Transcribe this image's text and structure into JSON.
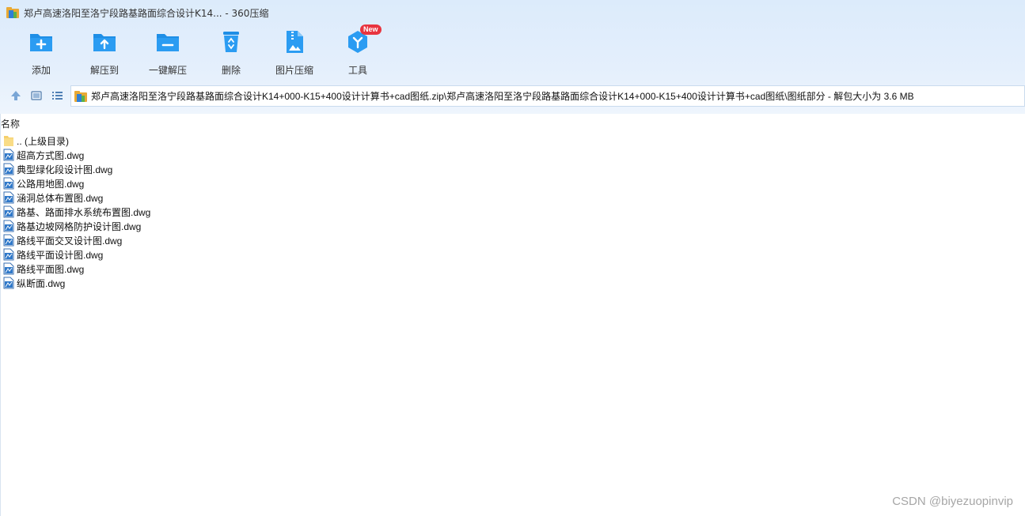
{
  "window": {
    "title": "郑卢高速洛阳至洛宁段路基路面综合设计K14... - 360压缩"
  },
  "toolbar": {
    "items": [
      {
        "label": "添加",
        "icon": "add-folder-icon"
      },
      {
        "label": "解压到",
        "icon": "extract-to-icon"
      },
      {
        "label": "一键解压",
        "icon": "one-click-extract-icon"
      },
      {
        "label": "删除",
        "icon": "recycle-bin-icon"
      },
      {
        "label": "图片压缩",
        "icon": "image-compress-icon"
      },
      {
        "label": "工具",
        "icon": "tools-icon",
        "badge": "New"
      }
    ]
  },
  "navigation": {
    "path": "郑卢高速洛阳至洛宁段路基路面综合设计K14+000-K15+400设计计算书+cad图纸.zip\\郑卢高速洛阳至洛宁段路基路面综合设计K14+000-K15+400设计计算书+cad图纸\\图纸部分 - 解包大小为 3.6 MB"
  },
  "list": {
    "column_name": "名称",
    "parent_dir": ".. (上级目录)",
    "files": [
      "超高方式图.dwg",
      "典型绿化段设计图.dwg",
      "公路用地图.dwg",
      "涵洞总体布置图.dwg",
      "路基、路面排水系统布置图.dwg",
      "路基边坡网格防护设计图.dwg",
      "路线平面交叉设计图.dwg",
      "路线平面设计图.dwg",
      "路线平面图.dwg",
      "纵断面.dwg"
    ]
  },
  "watermark": "CSDN @biyezuopinvip",
  "colors": {
    "accent": "#1e8ee6",
    "topbar_bg": "#dcebfb",
    "badge": "#e8343f"
  }
}
